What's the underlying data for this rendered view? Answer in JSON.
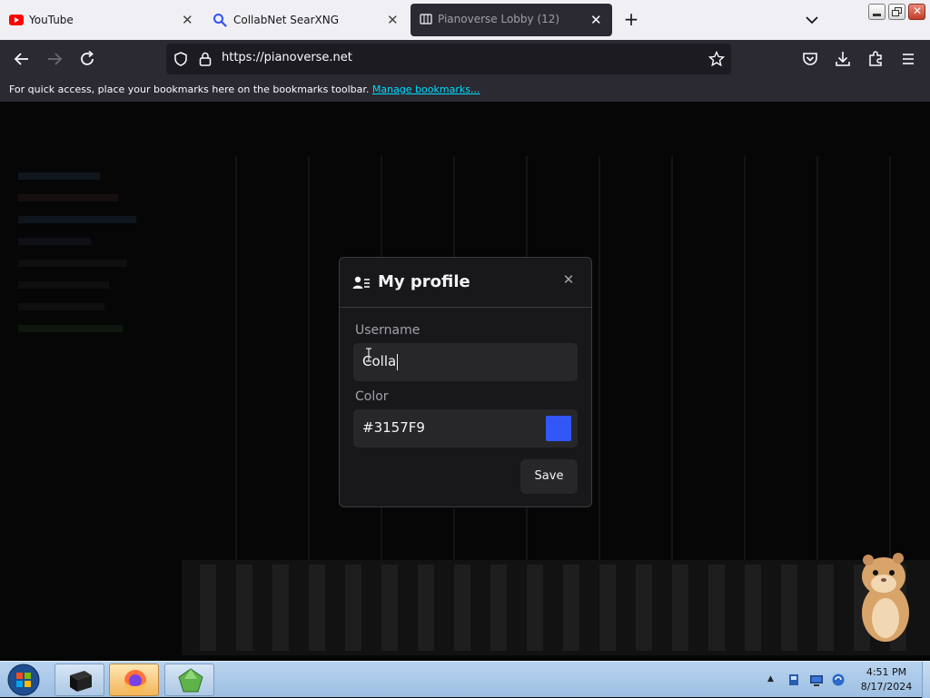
{
  "browser": {
    "tabs": [
      {
        "title": "YouTube",
        "active": false
      },
      {
        "title": "CollabNet SearXNG",
        "active": false
      },
      {
        "title": "Pianoverse Lobby (12)",
        "active": true
      }
    ],
    "url": "https://pianoverse.net",
    "bookmarks_message": "For quick access, place your bookmarks here on the bookmarks toolbar.",
    "bookmarks_link": "Manage bookmarks..."
  },
  "modal": {
    "title": "My profile",
    "username_label": "Username",
    "username_value": "Colla",
    "color_label": "Color",
    "color_value": "#3157F9",
    "save_label": "Save"
  },
  "taskbar": {
    "time": "4:51 PM",
    "date": "8/17/2024"
  },
  "colors": {
    "accent_swatch": "#3157F9",
    "modal_bg": "#18181b",
    "browser_chrome": "#2b2a33"
  }
}
